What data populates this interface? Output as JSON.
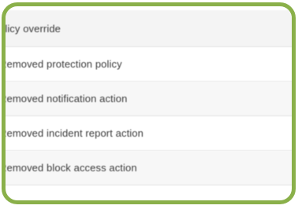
{
  "audit_list": {
    "rows": [
      {
        "label": "olicy override"
      },
      {
        "label": "Removed protection policy"
      },
      {
        "label": "Removed notification action"
      },
      {
        "label": "Removed incident report action"
      },
      {
        "label": "Removed block access action"
      }
    ]
  },
  "highlight": {
    "border_color": "#8ab04a"
  }
}
